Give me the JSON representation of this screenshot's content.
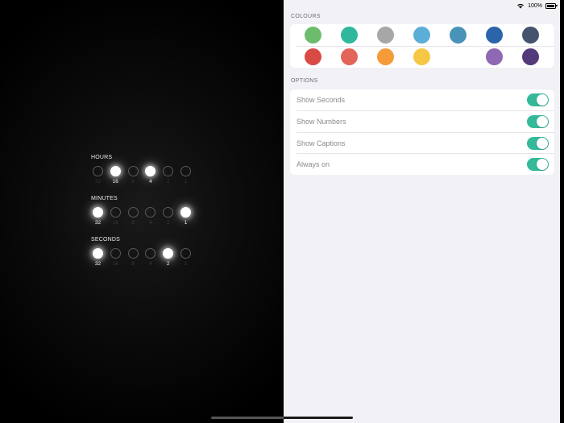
{
  "status_bar": {
    "battery_text": "100%"
  },
  "clock": {
    "groups": [
      {
        "title": "HOURS",
        "captions": [
          "32",
          "16",
          "8",
          "4",
          "2",
          "1"
        ],
        "on": [
          false,
          true,
          false,
          true,
          false,
          false
        ]
      },
      {
        "title": "MINUTES",
        "captions": [
          "32",
          "16",
          "8",
          "4",
          "2",
          "1"
        ],
        "on": [
          true,
          false,
          false,
          false,
          false,
          true
        ]
      },
      {
        "title": "SECONDS",
        "captions": [
          "32",
          "16",
          "8",
          "4",
          "2",
          "1"
        ],
        "on": [
          true,
          false,
          false,
          false,
          true,
          false
        ]
      }
    ]
  },
  "settings": {
    "colours_header": "COLOURS",
    "colours": [
      [
        "#6dbc6d",
        "#2fb89b",
        "#a7a7a7",
        "#5aaed8",
        "#4a93b8",
        "#2c64ab",
        "#44536e"
      ],
      [
        "#d94a45",
        "#e36459",
        "#f59b3a",
        "#f6c744",
        null,
        "#8f67b5",
        "#533a7d"
      ]
    ],
    "options_header": "OPTIONS",
    "options": [
      {
        "label": "Show Seconds",
        "enabled": true
      },
      {
        "label": "Show Numbers",
        "enabled": true
      },
      {
        "label": "Show Captions",
        "enabled": true
      },
      {
        "label": "Always on",
        "enabled": true
      }
    ],
    "toggle_color": "#34b99a"
  }
}
